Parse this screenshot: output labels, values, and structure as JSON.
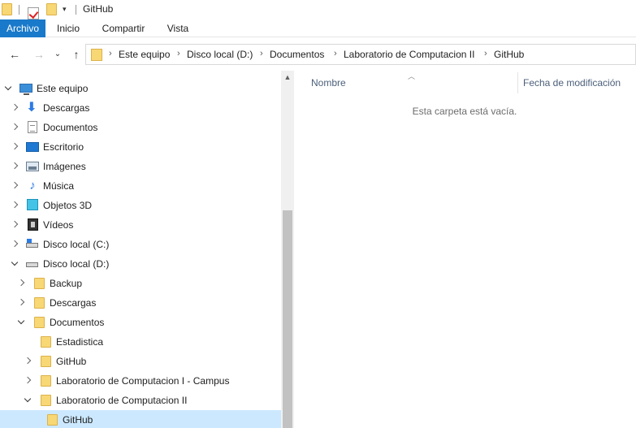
{
  "window": {
    "title": "GitHub"
  },
  "ribbon": {
    "tabs": [
      "Archivo",
      "Inicio",
      "Compartir",
      "Vista"
    ]
  },
  "address": {
    "crumbs": [
      "Este equipo",
      "Disco local (D:)",
      "Documentos",
      "Laboratorio de Computacion II",
      "GitHub"
    ]
  },
  "nav": {
    "items": [
      {
        "label": "Este equipo",
        "icon": "computer-icon",
        "expanded": true
      },
      {
        "label": "Descargas",
        "icon": "download-icon"
      },
      {
        "label": "Documentos",
        "icon": "document-icon"
      },
      {
        "label": "Escritorio",
        "icon": "desktop-icon"
      },
      {
        "label": "Imágenes",
        "icon": "pictures-icon"
      },
      {
        "label": "Música",
        "icon": "music-icon"
      },
      {
        "label": "Objetos 3D",
        "icon": "3d-objects-icon"
      },
      {
        "label": "Vídeos",
        "icon": "videos-icon"
      },
      {
        "label": "Disco local (C:)",
        "icon": "drive-c-icon"
      },
      {
        "label": "Disco local (D:)",
        "icon": "drive-icon",
        "expanded": true
      },
      {
        "label": "Backup",
        "icon": "folder-icon"
      },
      {
        "label": "Descargas",
        "icon": "folder-icon"
      },
      {
        "label": "Documentos",
        "icon": "folder-icon",
        "expanded": true
      },
      {
        "label": "Estadistica",
        "icon": "folder-icon"
      },
      {
        "label": "GitHub",
        "icon": "folder-icon"
      },
      {
        "label": "Laboratorio de Computacion I - Campus",
        "icon": "folder-icon"
      },
      {
        "label": "Laboratorio de Computacion II",
        "icon": "folder-icon",
        "expanded": true
      },
      {
        "label": "GitHub",
        "icon": "folder-icon",
        "selected": true
      }
    ]
  },
  "content": {
    "columns": [
      "Nombre",
      "Fecha de modificación"
    ],
    "empty_message": "Esta carpeta está vacía."
  },
  "colors": {
    "accent": "#1979ca",
    "selection": "#cce8ff",
    "folder": "#f8d775"
  }
}
